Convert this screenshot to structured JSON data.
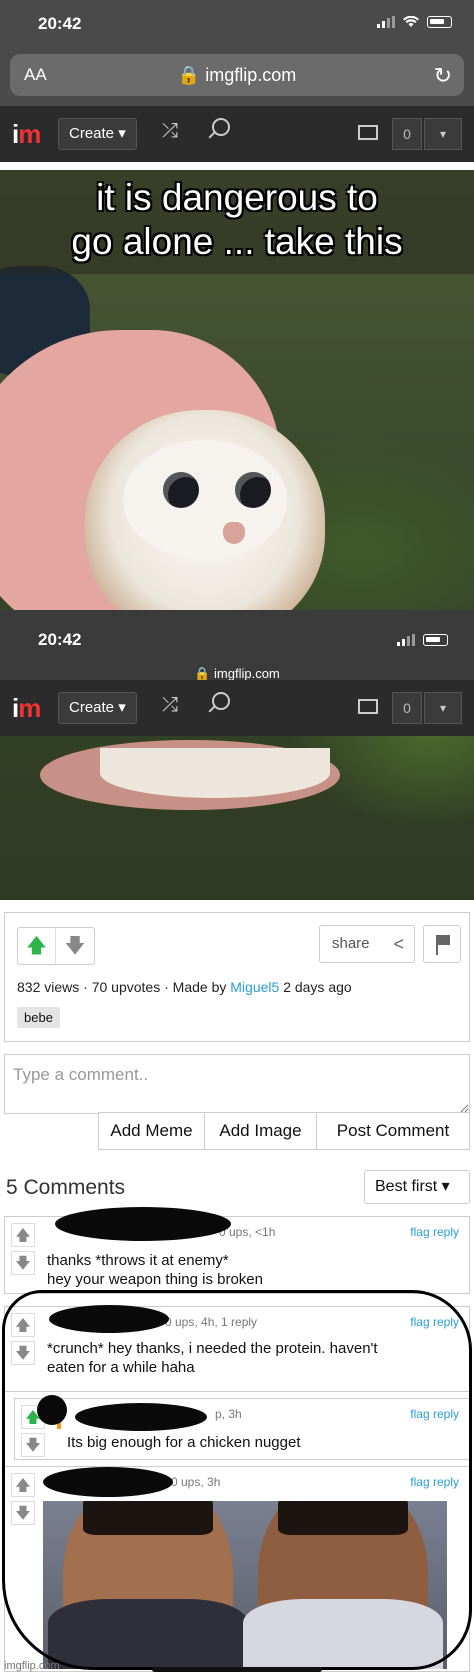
{
  "status_bar": {
    "time": "20:42"
  },
  "browser": {
    "aa_label": "AA",
    "url": "imgflip.com",
    "lock_glyph": "🔒",
    "reload_glyph": "↻"
  },
  "nav": {
    "logo_i": "i",
    "logo_m": "m",
    "create_label": "Create ▾",
    "shuffle_glyph": "⤮",
    "notification_count": "0",
    "dropdown_glyph": "▾"
  },
  "meme": {
    "caption_line1": "it is dangerous to",
    "caption_line2": "go alone ... take this",
    "embedded_status_time": "20:42",
    "embedded_url": "🔒 imgflip.com",
    "embedded_nav_create": "Create ▾",
    "embedded_nav_count": "0"
  },
  "post": {
    "views": "832 views",
    "upvotes": "70 upvotes",
    "made_by": "Made by",
    "username": "Miguel5",
    "age": "2 days ago",
    "tag": "bebe",
    "share_label": "share",
    "share_glyph": "<",
    "upvote_glyph": "🡅",
    "downvote_glyph": "🡇"
  },
  "comment_form": {
    "placeholder": "Type a comment..",
    "buttons": [
      "Add Meme",
      "Add Image",
      "Post Comment"
    ]
  },
  "comments_header": {
    "count_label": "5 Comments",
    "sort_label": "Best first ▾"
  },
  "comments": [
    {
      "meta": "0 ups, <1h",
      "text_line1": "thanks *throws it at enemy*",
      "text_line2": "hey your weapon thing is broken",
      "flag": "flag",
      "reply": "reply"
    },
    {
      "meta": "0 ups, 4h, 1 reply",
      "text_line1": "*crunch* hey thanks, i needed the protein. haven't",
      "text_line2": "eaten for a while haha",
      "flag": "flag",
      "reply": "reply"
    },
    {
      "meta": "p, 3h",
      "text_line1": "Its big enough for a chicken nugget",
      "flag": "flag",
      "reply": "reply"
    },
    {
      "meta": "0 ups, 3h",
      "flag": "flag",
      "reply": "reply"
    }
  ],
  "watermark": "imgflip.com"
}
